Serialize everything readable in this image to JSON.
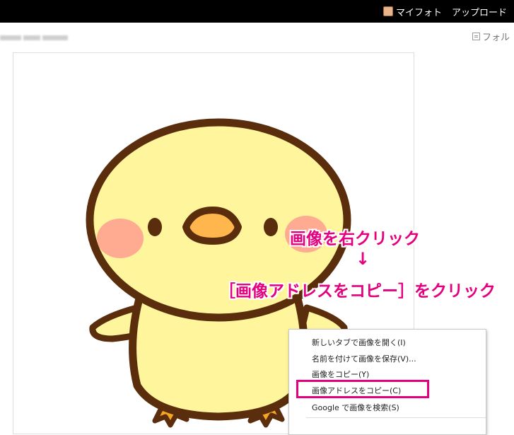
{
  "header": {
    "nav": [
      {
        "label": "マイフォト",
        "icon": "avatar-icon"
      },
      {
        "label": "アップロード"
      }
    ]
  },
  "folder_link": {
    "label": "フォル",
    "icon": "folder-icon"
  },
  "annotation": {
    "step1": "画像を右クリック",
    "arrow": "↓",
    "step2": "［画像アドレスをコピー］をクリック",
    "color": "#e4007f"
  },
  "context_menu": {
    "items": [
      "新しいタブで画像を開く(I)",
      "名前を付けて画像を保存(V)...",
      "画像をコピー(Y)",
      "画像アドレスをコピー(C)",
      "Google で画像を検索(S)"
    ],
    "highlighted_index": 3
  },
  "colors": {
    "chick_body": "#fff59d",
    "chick_outline": "#5a2d0c",
    "beak": "#ffb74d",
    "cheek": "#ffab91",
    "feet": "#f5a623"
  }
}
